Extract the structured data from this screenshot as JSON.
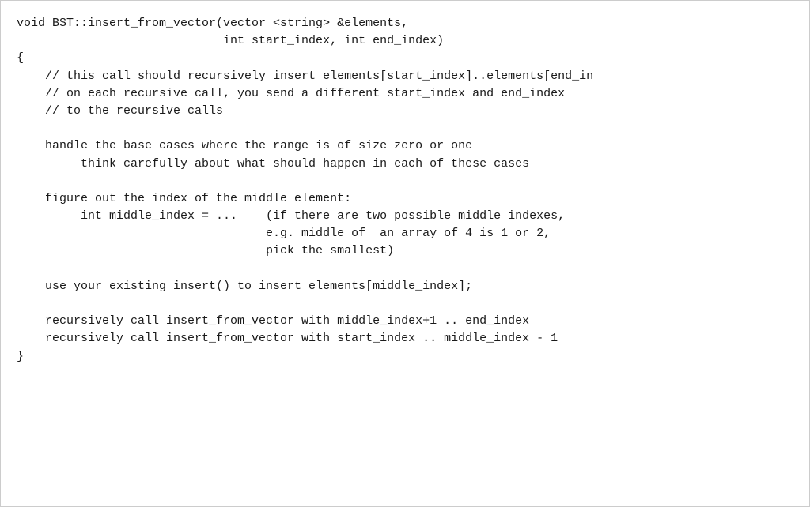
{
  "code": {
    "lines": [
      "void BST::insert_from_vector(vector <string> &elements,",
      "                             int start_index, int end_index)",
      "{",
      "    // this call should recursively insert elements[start_index]..elements[end_in",
      "    // on each recursive call, you send a different start_index and end_index",
      "    // to the recursive calls",
      "",
      "    handle the base cases where the range is of size zero or one",
      "         think carefully about what should happen in each of these cases",
      "",
      "    figure out the index of the middle element:",
      "         int middle_index = ...    (if there are two possible middle indexes,",
      "                                   e.g. middle of  an array of 4 is 1 or 2,",
      "                                   pick the smallest)",
      "",
      "    use your existing insert() to insert elements[middle_index];",
      "",
      "    recursively call insert_from_vector with middle_index+1 .. end_index",
      "    recursively call insert_from_vector with start_index .. middle_index - 1",
      "}"
    ]
  }
}
